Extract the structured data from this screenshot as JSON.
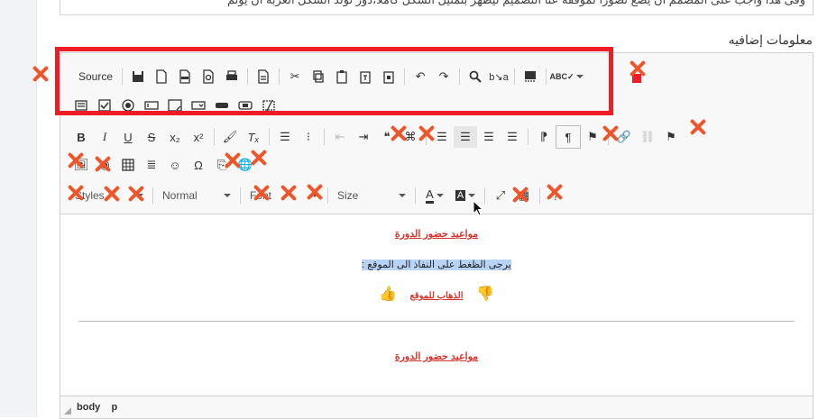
{
  "top_textarea_text": "وفى هذا واجب على المصمم أن يضع تصورا لموقفة عنا التصميم ليظهر بتمثيل الشكل كاملا،دور تولد الشكل العربة أن يوتم",
  "field_label": "معلومات إضافيه",
  "toolbar": {
    "source_label": "Source",
    "styles_label": "Styles",
    "format_label": "Normal",
    "font_label": "Font",
    "size_label": "Size"
  },
  "content": {
    "heading1": "مواعيد حضور الدورة",
    "instruction": "يرجى الظغط على النفاذ الى الموقع :",
    "go_link": "الذهاب للموقع",
    "heading2": "مواعيد حضور الدورة"
  },
  "status_path": [
    "body",
    "p"
  ]
}
